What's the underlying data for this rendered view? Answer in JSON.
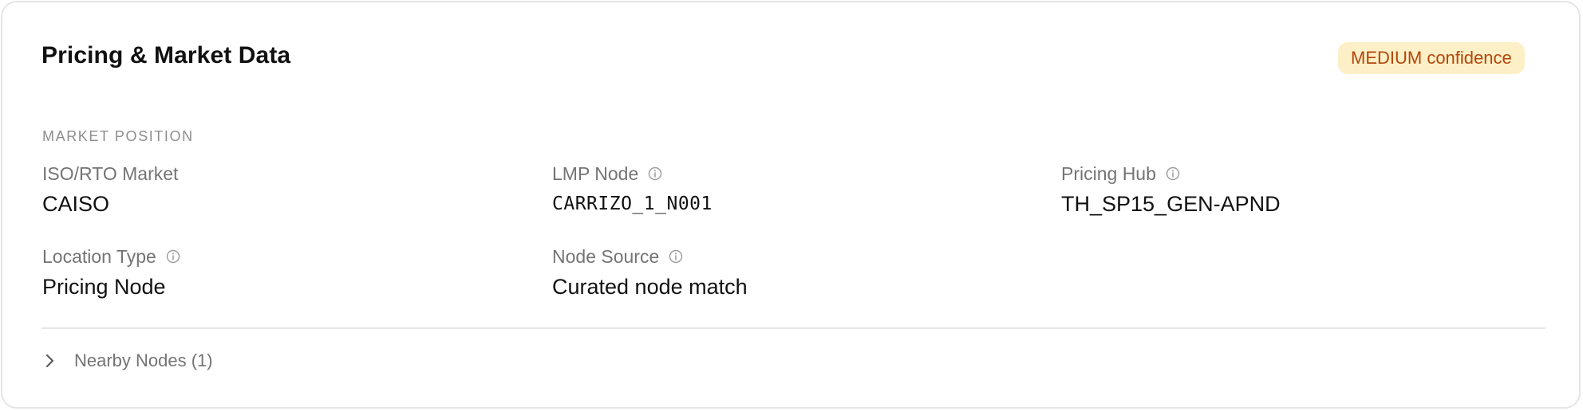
{
  "card": {
    "title": "Pricing & Market Data",
    "confidence_badge": "MEDIUM confidence"
  },
  "market_position": {
    "section_label": "MARKET POSITION",
    "fields": {
      "iso_rto_market": {
        "label": "ISO/RTO Market",
        "value": "CAISO",
        "has_info_icon": false
      },
      "lmp_node": {
        "label": "LMP Node",
        "value": "CARRIZO_1_N001",
        "has_info_icon": true
      },
      "pricing_hub": {
        "label": "Pricing Hub",
        "value": "TH_SP15_GEN-APND",
        "has_info_icon": true
      },
      "location_type": {
        "label": "Location Type",
        "value": "Pricing Node",
        "has_info_icon": true
      },
      "node_source": {
        "label": "Node Source",
        "value": "Curated node match",
        "has_info_icon": true
      }
    }
  },
  "nearby_nodes": {
    "label": "Nearby Nodes (1)",
    "expanded": false,
    "icon": "chevron-right-icon"
  },
  "colors": {
    "badge_background": "#fdf0c6",
    "badge_text": "#b5450b",
    "muted_text": "#747474"
  }
}
